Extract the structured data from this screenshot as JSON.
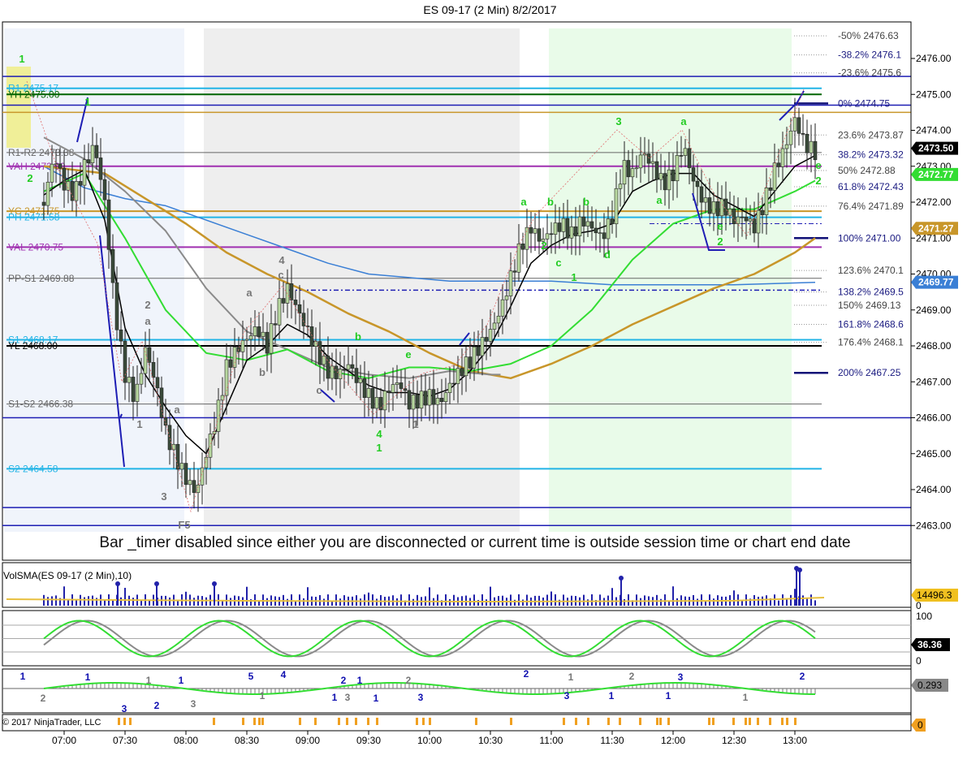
{
  "window": {
    "title": "ES 09-17 (2 Min)  8/2/2017"
  },
  "colors": {
    "candle_up": "#b8d8a0",
    "candle_down": "#3a4a3a",
    "ema_black": "#000000",
    "ema_green": "#33dd33",
    "ema_gold": "#c8962a",
    "ema_gray": "#8a8a8a",
    "ema_blue": "#3a7fd5",
    "pivot_blue": "#1e1eb4",
    "cyan": "#22b4e6",
    "purple": "#a030b0",
    "dark_green": "#006400",
    "session_shade": "#eeeeee",
    "green_shade": "#e9fbe9",
    "blue_shade": "#f0f4fb",
    "label_green": "#22cc22",
    "label_gray": "#777777",
    "label_blue": "#1010b0"
  },
  "chart_data": [
    {
      "type": "candlestick",
      "title": "ES 09-17 (2 Min)  8/2/2017",
      "x": [
        "07:00",
        "07:30",
        "08:00",
        "08:30",
        "09:00",
        "09:30",
        "10:00",
        "10:30",
        "11:00",
        "11:30",
        "12:00",
        "12:30",
        "13:00"
      ],
      "ylim": [
        2462.6,
        2477.0
      ],
      "y_ticks": [
        "2476.00",
        "2475.00",
        "2474.00",
        "2473.00",
        "2472.00",
        "2471.00",
        "2470.00",
        "2469.00",
        "2468.00",
        "2467.00",
        "2466.00",
        "2465.00",
        "2464.00",
        "2463.00"
      ],
      "close_path": [
        [
          "06:50",
          2472.0
        ],
        [
          "06:55",
          2473.3
        ],
        [
          "07:00",
          2472.5
        ],
        [
          "07:05",
          2472.2
        ],
        [
          "07:10",
          2473.0
        ],
        [
          "07:15",
          2473.6
        ],
        [
          "07:20",
          2472.0
        ],
        [
          "07:25",
          2469.0
        ],
        [
          "07:30",
          2467.2
        ],
        [
          "07:35",
          2466.5
        ],
        [
          "07:40",
          2467.9
        ],
        [
          "07:45",
          2467.0
        ],
        [
          "07:50",
          2465.6
        ],
        [
          "07:55",
          2464.9
        ],
        [
          "08:00",
          2464.3
        ],
        [
          "08:05",
          2463.9
        ],
        [
          "08:10",
          2465.0
        ],
        [
          "08:15",
          2466.0
        ],
        [
          "08:20",
          2467.4
        ],
        [
          "08:25",
          2467.9
        ],
        [
          "08:30",
          2468.2
        ],
        [
          "08:35",
          2468.5
        ],
        [
          "08:40",
          2468.0
        ],
        [
          "08:45",
          2469.0
        ],
        [
          "08:50",
          2469.6
        ],
        [
          "08:55",
          2469.0
        ],
        [
          "09:00",
          2468.4
        ],
        [
          "09:05",
          2467.8
        ],
        [
          "09:10",
          2467.3
        ],
        [
          "09:15",
          2467.2
        ],
        [
          "09:20",
          2467.5
        ],
        [
          "09:25",
          2467.0
        ],
        [
          "09:30",
          2466.6
        ],
        [
          "09:35",
          2466.3
        ],
        [
          "09:40",
          2466.8
        ],
        [
          "09:45",
          2467.0
        ],
        [
          "09:50",
          2466.4
        ],
        [
          "09:55",
          2466.5
        ],
        [
          "10:00",
          2466.6
        ],
        [
          "10:05",
          2466.4
        ],
        [
          "10:10",
          2466.9
        ],
        [
          "10:15",
          2467.3
        ],
        [
          "10:20",
          2467.6
        ],
        [
          "10:25",
          2468.0
        ],
        [
          "10:30",
          2468.4
        ],
        [
          "10:35",
          2469.0
        ],
        [
          "10:40",
          2469.9
        ],
        [
          "10:45",
          2470.8
        ],
        [
          "10:50",
          2471.3
        ],
        [
          "10:55",
          2470.9
        ],
        [
          "11:00",
          2471.2
        ],
        [
          "11:05",
          2471.4
        ],
        [
          "11:10",
          2471.1
        ],
        [
          "11:15",
          2471.5
        ],
        [
          "11:20",
          2471.3
        ],
        [
          "11:25",
          2471.0
        ],
        [
          "11:30",
          2471.6
        ],
        [
          "11:35",
          2473.0
        ],
        [
          "11:40",
          2472.8
        ],
        [
          "11:45",
          2473.4
        ],
        [
          "11:50",
          2473.0
        ],
        [
          "11:55",
          2472.5
        ],
        [
          "12:00",
          2472.8
        ],
        [
          "12:05",
          2473.6
        ],
        [
          "12:10",
          2472.6
        ],
        [
          "12:15",
          2472.0
        ],
        [
          "12:20",
          2471.8
        ],
        [
          "12:25",
          2471.9
        ],
        [
          "12:30",
          2471.5
        ],
        [
          "12:35",
          2471.6
        ],
        [
          "12:40",
          2471.3
        ],
        [
          "12:45",
          2472.0
        ],
        [
          "12:50",
          2472.9
        ],
        [
          "12:55",
          2473.5
        ],
        [
          "13:00",
          2474.3
        ],
        [
          "13:05",
          2473.6
        ],
        [
          "13:10",
          2473.4
        ]
      ],
      "ema_black": [
        [
          "06:50",
          2472.2
        ],
        [
          "07:00",
          2472.6
        ],
        [
          "07:10",
          2472.9
        ],
        [
          "07:20",
          2471.5
        ],
        [
          "07:30",
          2468.5
        ],
        [
          "07:40",
          2467.2
        ],
        [
          "07:50",
          2466.3
        ],
        [
          "08:00",
          2465.5
        ],
        [
          "08:10",
          2465.0
        ],
        [
          "08:20",
          2466.3
        ],
        [
          "08:30",
          2467.6
        ],
        [
          "08:40",
          2468.0
        ],
        [
          "08:50",
          2468.6
        ],
        [
          "09:00",
          2468.3
        ],
        [
          "09:10",
          2467.7
        ],
        [
          "09:20",
          2467.3
        ],
        [
          "09:30",
          2466.9
        ],
        [
          "09:40",
          2466.7
        ],
        [
          "09:50",
          2466.7
        ],
        [
          "10:00",
          2466.6
        ],
        [
          "10:10",
          2466.8
        ],
        [
          "10:20",
          2467.3
        ],
        [
          "10:30",
          2468.0
        ],
        [
          "10:40",
          2469.1
        ],
        [
          "10:50",
          2470.3
        ],
        [
          "11:00",
          2470.8
        ],
        [
          "11:10",
          2471.1
        ],
        [
          "11:20",
          2471.2
        ],
        [
          "11:30",
          2471.4
        ],
        [
          "11:40",
          2472.3
        ],
        [
          "11:50",
          2472.6
        ],
        [
          "12:00",
          2472.8
        ],
        [
          "12:10",
          2472.8
        ],
        [
          "12:20",
          2472.2
        ],
        [
          "12:30",
          2471.9
        ],
        [
          "12:40",
          2471.6
        ],
        [
          "12:50",
          2472.3
        ],
        [
          "13:00",
          2473.0
        ],
        [
          "13:10",
          2473.3
        ]
      ],
      "ema_green": [
        [
          "06:50",
          2472.3
        ],
        [
          "07:10",
          2472.8
        ],
        [
          "07:30",
          2471.0
        ],
        [
          "07:50",
          2469.0
        ],
        [
          "08:10",
          2467.8
        ],
        [
          "08:30",
          2467.6
        ],
        [
          "08:50",
          2467.9
        ],
        [
          "09:10",
          2467.3
        ],
        [
          "09:30",
          2467.1
        ],
        [
          "09:50",
          2467.4
        ],
        [
          "10:00",
          2467.4
        ],
        [
          "10:20",
          2467.3
        ],
        [
          "10:40",
          2467.5
        ],
        [
          "11:00",
          2468.0
        ],
        [
          "11:20",
          2469.0
        ],
        [
          "11:40",
          2470.4
        ],
        [
          "12:00",
          2471.4
        ],
        [
          "12:20",
          2471.8
        ],
        [
          "12:40",
          2471.8
        ],
        [
          "13:00",
          2472.3
        ],
        [
          "13:10",
          2472.6
        ]
      ],
      "ema_gray": [
        [
          "06:50",
          2473.8
        ],
        [
          "07:10",
          2473.2
        ],
        [
          "07:30",
          2472.3
        ],
        [
          "07:50",
          2471.2
        ],
        [
          "08:10",
          2469.6
        ],
        [
          "08:30",
          2468.4
        ],
        [
          "08:50",
          2467.9
        ],
        [
          "09:10",
          2467.4
        ],
        [
          "09:30",
          2467.2
        ],
        [
          "09:50",
          2467.1
        ],
        [
          "10:10",
          2467.3
        ],
        [
          "10:30",
          2467.2
        ],
        [
          "10:35",
          2467.2
        ]
      ],
      "ema_gold": [
        [
          "06:50",
          2473.0
        ],
        [
          "07:20",
          2472.8
        ],
        [
          "07:40",
          2472.1
        ],
        [
          "08:00",
          2471.4
        ],
        [
          "08:20",
          2470.6
        ],
        [
          "08:40",
          2470.0
        ],
        [
          "09:00",
          2469.5
        ],
        [
          "09:20",
          2468.9
        ],
        [
          "09:40",
          2468.4
        ],
        [
          "10:00",
          2467.8
        ],
        [
          "10:20",
          2467.3
        ],
        [
          "10:40",
          2467.1
        ],
        [
          "11:00",
          2467.5
        ],
        [
          "11:20",
          2468.0
        ],
        [
          "11:40",
          2468.6
        ],
        [
          "12:00",
          2469.1
        ],
        [
          "12:20",
          2469.6
        ],
        [
          "12:40",
          2470.0
        ],
        [
          "13:00",
          2470.6
        ],
        [
          "13:10",
          2471.0
        ]
      ],
      "ema_blue": [
        [
          "06:50",
          2473.0
        ],
        [
          "07:10",
          2472.4
        ],
        [
          "07:30",
          2472.1
        ],
        [
          "07:50",
          2471.9
        ],
        [
          "08:10",
          2471.5
        ],
        [
          "08:30",
          2471.1
        ],
        [
          "08:50",
          2470.7
        ],
        [
          "09:10",
          2470.3
        ],
        [
          "09:30",
          2470.0
        ],
        [
          "09:50",
          2469.9
        ],
        [
          "10:10",
          2469.8
        ],
        [
          "10:30",
          2469.8
        ],
        [
          "11:00",
          2469.8
        ],
        [
          "11:30",
          2469.7
        ],
        [
          "12:00",
          2469.7
        ],
        [
          "12:30",
          2469.7
        ],
        [
          "13:10",
          2469.77
        ]
      ],
      "horizontal_levels": [
        {
          "label": "R1-R2 2473.38",
          "value": 2473.38,
          "color": "#666666"
        },
        {
          "label": "VAH 2473.00",
          "value": 2473.0,
          "color": "#a030b0"
        },
        {
          "label": "YC 2471.75",
          "value": 2471.75,
          "color": "#c8962a"
        },
        {
          "label": "PH 2471.58",
          "value": 2471.58,
          "color": "#22b4e6"
        },
        {
          "label": "VAL 2470.75",
          "value": 2470.75,
          "color": "#a030b0"
        },
        {
          "label": "PP-S1 2469.88",
          "value": 2469.88,
          "color": "#666666"
        },
        {
          "label": "S1 2468.17",
          "value": 2468.17,
          "color": "#22b4e6"
        },
        {
          "label": "YL 2468.00",
          "value": 2468.0,
          "color": "#000000"
        },
        {
          "label": "S1-S2 2466.38",
          "value": 2466.38,
          "color": "#666666"
        },
        {
          "label": "S2 2464.58",
          "value": 2464.58,
          "color": "#22b4e6"
        },
        {
          "label": "R1 2475.17",
          "value": 2475.17,
          "color": "#22b4e6"
        },
        {
          "label": "YH 2475.00",
          "value": 2475.0,
          "color": "#006400"
        }
      ],
      "fib_levels": [
        {
          "label": "-50%",
          "value": "2476.63"
        },
        {
          "label": "-38.2%",
          "value": "2476.1"
        },
        {
          "label": "-23.6%",
          "value": "2475.6"
        },
        {
          "label": "0%",
          "value": "2474.75"
        },
        {
          "label": "23.6%",
          "value": "2473.87"
        },
        {
          "label": "38.2%",
          "value": "2473.32"
        },
        {
          "label": "50%",
          "value": "2472.88"
        },
        {
          "label": "61.8%",
          "value": "2472.43"
        },
        {
          "label": "76.4%",
          "value": "2471.89"
        },
        {
          "label": "100%",
          "value": "2471.00"
        },
        {
          "label": "123.6%",
          "value": "2470.1"
        },
        {
          "label": "138.2%",
          "value": "2469.5"
        },
        {
          "label": "150%",
          "value": "2469.13"
        },
        {
          "label": "161.8%",
          "value": "2468.6"
        },
        {
          "label": "176.4%",
          "value": "2468.1"
        },
        {
          "label": "200%",
          "value": "2467.25"
        }
      ],
      "price_flags": [
        {
          "value": "2473.50",
          "color": "#000000"
        },
        {
          "value": "2472.77",
          "color": "#33dd33"
        },
        {
          "value": "2471.27",
          "color": "#c8962a"
        },
        {
          "value": "2469.77",
          "color": "#3a7fd5"
        }
      ],
      "wave_labels_green": [
        "1",
        "2",
        "1",
        "a",
        "2",
        "b",
        "1",
        "b",
        "d",
        "a",
        "c",
        "e",
        "2",
        "3",
        "a",
        "b",
        "e",
        "4",
        "1",
        "e",
        "2"
      ],
      "wave_labels_gray": [
        "1",
        "2",
        "a",
        "3",
        "F5",
        "a",
        "a",
        "b",
        "4",
        "c",
        "c",
        "1"
      ],
      "notice": "Bar _timer disabled since either you are disconnected or current time is outside session time or chart end date"
    },
    {
      "type": "bar",
      "title": "VolSMA(ES 09-17 (2 Min),10)",
      "ylim": [
        0,
        30000
      ],
      "last_value": "14496.3",
      "y_ticks": [
        "0"
      ]
    },
    {
      "type": "line",
      "title": "stochastics",
      "ylim": [
        0,
        100
      ],
      "y_ticks": [
        "100",
        "0"
      ],
      "last_value": "36.36"
    },
    {
      "type": "area",
      "title": "momentum",
      "last_value": "0.293",
      "wave_labels": [
        "1",
        "2",
        "1",
        "3",
        "1",
        "2",
        "1",
        "3",
        "5",
        "4",
        "1",
        "1",
        "2",
        "3",
        "1",
        "1",
        "2",
        "3",
        "2",
        "1",
        "3",
        "1",
        "2",
        "1",
        "3",
        "1",
        "2"
      ]
    },
    {
      "type": "bar",
      "title": "markers",
      "last_value": "0"
    }
  ],
  "footer": {
    "copyright": "© 2017 NinjaTrader, LLC"
  }
}
